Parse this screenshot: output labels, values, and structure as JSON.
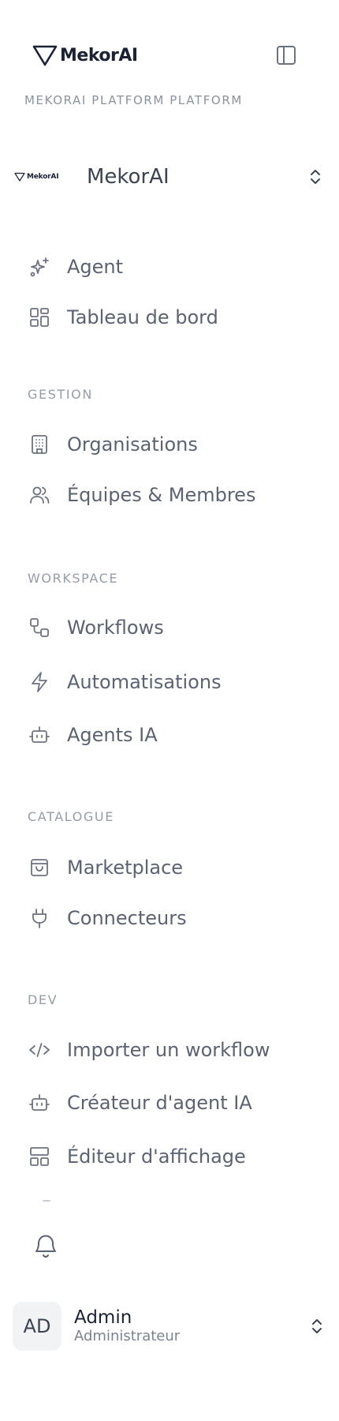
{
  "brand": {
    "name": "MekorAI"
  },
  "platform_label": "MEKORAI PLATFORM PLATFORM",
  "org": {
    "logo_text": "MekorAI",
    "name": "MekorAI"
  },
  "top_items": [
    {
      "label": "Agent",
      "icon": "sparkles-icon"
    },
    {
      "label": "Tableau de bord",
      "icon": "dashboard-icon"
    }
  ],
  "sections": {
    "gestion": {
      "label": "GESTION",
      "items": [
        {
          "label": "Organisations",
          "icon": "building-icon"
        },
        {
          "label": "Équipes & Membres",
          "icon": "users-icon"
        }
      ]
    },
    "workspace": {
      "label": "WORKSPACE",
      "items": [
        {
          "label": "Workflows",
          "icon": "workflow-icon"
        },
        {
          "label": "Automatisations",
          "icon": "zap-icon"
        },
        {
          "label": "Agents IA",
          "icon": "bot-icon"
        }
      ]
    },
    "catalogue": {
      "label": "CATALOGUE",
      "items": [
        {
          "label": "Marketplace",
          "icon": "shopping-bag-icon"
        },
        {
          "label": "Connecteurs",
          "icon": "plug-icon"
        }
      ]
    },
    "dev": {
      "label": "DEV",
      "items": [
        {
          "label": "Importer un workflow",
          "icon": "code-icon"
        },
        {
          "label": "Créateur d'agent IA",
          "icon": "bot-icon"
        },
        {
          "label": "Éditeur d'affichage",
          "icon": "layout-icon"
        }
      ]
    }
  },
  "user": {
    "initials": "AD",
    "name": "Admin",
    "role": "Administrateur"
  },
  "colors": {
    "text": "#5b6373",
    "section": "#959caa",
    "brand": "#1a2233",
    "avatar_bg": "#f1f3f5"
  }
}
